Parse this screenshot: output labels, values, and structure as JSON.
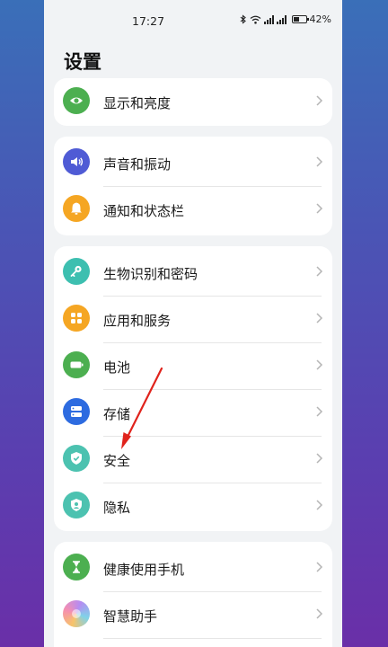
{
  "status": {
    "time": "17:27",
    "battery": "42%"
  },
  "page": {
    "title": "设置"
  },
  "groups": [
    {
      "items": [
        {
          "label": "显示和亮度",
          "icon": "eye-icon",
          "color": "#4caf50"
        }
      ]
    },
    {
      "items": [
        {
          "label": "声音和振动",
          "icon": "speaker-icon",
          "color": "#4f5bd5"
        },
        {
          "label": "通知和状态栏",
          "icon": "bell-icon",
          "color": "#f5a623"
        }
      ]
    },
    {
      "items": [
        {
          "label": "生物识别和密码",
          "icon": "key-icon",
          "color": "#3dbfb0"
        },
        {
          "label": "应用和服务",
          "icon": "apps-grid-icon",
          "color": "#f5a623"
        },
        {
          "label": "电池",
          "icon": "battery-icon",
          "color": "#4caf50"
        },
        {
          "label": "存储",
          "icon": "storage-icon",
          "color": "#2d6be0"
        },
        {
          "label": "安全",
          "icon": "shield-check-icon",
          "color": "#4cc2b0"
        },
        {
          "label": "隐私",
          "icon": "privacy-shield-icon",
          "color": "#4cc2b0"
        }
      ]
    },
    {
      "items": [
        {
          "label": "健康使用手机",
          "icon": "hourglass-icon",
          "color": "#4caf50"
        },
        {
          "label": "智慧助手",
          "icon": "assistant-orb-icon",
          "color": "#f09bb8"
        }
      ]
    }
  ]
}
